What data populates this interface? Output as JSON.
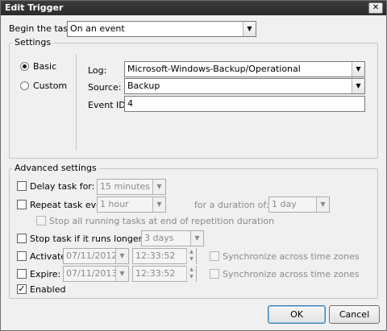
{
  "window": {
    "title": "Edit Trigger",
    "close_glyph": "✕"
  },
  "begin_task": {
    "label": "Begin the task:",
    "value": "On an event"
  },
  "settings": {
    "group_label": "Settings",
    "mode_options": [
      {
        "label": "Basic",
        "checked": true
      },
      {
        "label": "Custom",
        "checked": false
      }
    ],
    "log": {
      "label": "Log:",
      "value": "Microsoft-Windows-Backup/Operational"
    },
    "source": {
      "label": "Source:",
      "value": "Backup"
    },
    "event_id": {
      "label": "Event ID:",
      "value": "4"
    }
  },
  "advanced": {
    "group_label": "Advanced settings",
    "delay_task": {
      "label": "Delay task for:",
      "value": "15 minutes",
      "checked": false
    },
    "repeat_task": {
      "label": "Repeat task every:",
      "value": "1 hour",
      "checked": false
    },
    "duration": {
      "label": "for a duration of:",
      "value": "1 day"
    },
    "stop_running": {
      "label": "Stop all running tasks at end of repetition duration",
      "checked": false
    },
    "stop_task": {
      "label": "Stop task if it runs longer than:",
      "value": "3 days",
      "checked": false
    },
    "activate": {
      "label": "Activate:",
      "date": "07/11/2012",
      "time": "12:33:52",
      "checked": false
    },
    "expire": {
      "label": "Expire:",
      "date": "07/11/2013",
      "time": "12:33:52",
      "checked": false
    },
    "sync_activate": {
      "label": "Synchronize across time zones"
    },
    "sync_expire": {
      "label": "Synchronize across time zones"
    },
    "enabled": {
      "label": "Enabled",
      "checked": true
    }
  },
  "buttons": {
    "ok": "OK",
    "cancel": "Cancel"
  },
  "glyphs": {
    "dropdown": "▼",
    "check": "✓",
    "spin_up": "▲",
    "spin_down": "▼"
  },
  "icons": {
    "dropdown": "chevron-down-icon",
    "close": "close-icon"
  }
}
